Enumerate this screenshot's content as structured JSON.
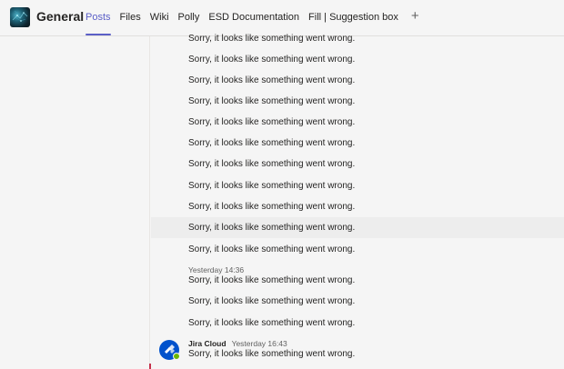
{
  "header": {
    "channel_name": "General",
    "tabs": [
      {
        "label": "Posts",
        "active": true
      },
      {
        "label": "Files",
        "active": false
      },
      {
        "label": "Wiki",
        "active": false
      },
      {
        "label": "Polly",
        "active": false
      },
      {
        "label": "ESD Documentation",
        "active": false
      },
      {
        "label": "Fill | Suggestion box",
        "active": false
      }
    ],
    "add_tab_icon": "+"
  },
  "messages": {
    "error_text": "Sorry, it looks like something went wrong.",
    "items": [
      {
        "text": "Sorry, it looks like something went wrong."
      },
      {
        "text": "Sorry, it looks like something went wrong."
      },
      {
        "text": "Sorry, it looks like something went wrong."
      },
      {
        "text": "Sorry, it looks like something went wrong."
      },
      {
        "text": "Sorry, it looks like something went wrong."
      },
      {
        "text": "Sorry, it looks like something went wrong."
      },
      {
        "text": "Sorry, it looks like something went wrong."
      },
      {
        "text": "Sorry, it looks like something went wrong."
      },
      {
        "text": "Sorry, it looks like something went wrong."
      },
      {
        "text": "Sorry, it looks like something went wrong."
      },
      {
        "text": "Sorry, it looks like something went wrong."
      },
      {
        "text": "Sorry, it looks like something went wrong."
      },
      {
        "text": "Sorry, it looks like something went wrong."
      },
      {
        "text": "Sorry, it looks like something went wrong."
      },
      {
        "text": "Sorry, it looks like something went wrong."
      }
    ],
    "timestamp_group": "Yesterday 14:36",
    "bot_sender": "Jira Cloud",
    "bot_timestamp": "Yesterday 16:43"
  },
  "colors": {
    "accent": "#5b5fc7",
    "jira_blue": "#0052cc",
    "presence_green": "#6bb700"
  }
}
